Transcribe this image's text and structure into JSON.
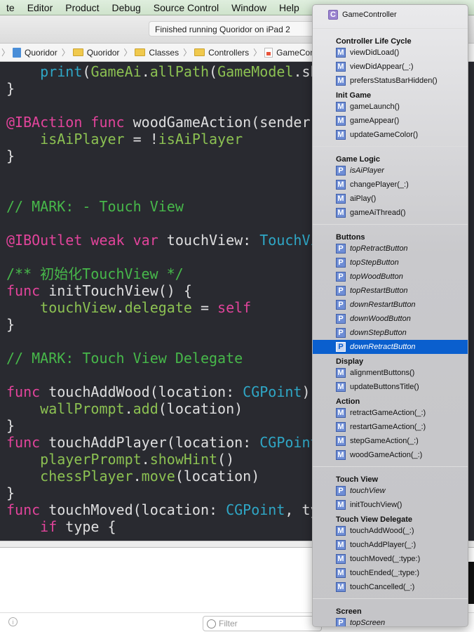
{
  "menubar": [
    "te",
    "Editor",
    "Product",
    "Debug",
    "Source Control",
    "Window",
    "Help"
  ],
  "toolbar": {
    "status": "Finished running Quoridor on iPad 2"
  },
  "breadcrumb": [
    {
      "icon": "project-icon",
      "label": "Quoridor"
    },
    {
      "icon": "folder-icon",
      "label": "Quoridor"
    },
    {
      "icon": "folder-icon",
      "label": "Classes"
    },
    {
      "icon": "folder-icon",
      "label": "Controllers"
    },
    {
      "icon": "swift-file-icon",
      "label": "GameController.swift"
    }
  ],
  "code": [
    [
      [
        "    ",
        "p"
      ],
      [
        "print",
        "t"
      ],
      [
        "(",
        "p"
      ],
      [
        "GameAi",
        "g"
      ],
      [
        ".",
        "p"
      ],
      [
        "allPath",
        "g"
      ],
      [
        "(",
        "p"
      ],
      [
        "GameModel",
        "g"
      ],
      [
        ".sh",
        "p"
      ]
    ],
    [
      [
        "}",
        "p"
      ]
    ],
    [],
    [
      [
        "@IBAction",
        "k"
      ],
      [
        " ",
        "p"
      ],
      [
        "func",
        "k"
      ],
      [
        " woodGameAction(sender",
        "p"
      ]
    ],
    [
      [
        "    ",
        "p"
      ],
      [
        "isAiPlayer",
        "g"
      ],
      [
        " = !",
        "p"
      ],
      [
        "isAiPlayer",
        "g"
      ]
    ],
    [
      [
        "}",
        "p"
      ]
    ],
    [],
    [],
    [
      [
        "// MARK: - Touch View",
        "c"
      ]
    ],
    [],
    [
      [
        "@IBOutlet",
        "k"
      ],
      [
        " ",
        "p"
      ],
      [
        "weak",
        "k"
      ],
      [
        " ",
        "p"
      ],
      [
        "var",
        "k"
      ],
      [
        " touchView: ",
        "p"
      ],
      [
        "TouchView",
        "t"
      ]
    ],
    [],
    [
      [
        "/** 初始化TouchView */",
        "c"
      ]
    ],
    [
      [
        "func",
        "k"
      ],
      [
        " initTouchView() {",
        "p"
      ]
    ],
    [
      [
        "    ",
        "p"
      ],
      [
        "touchView",
        "g"
      ],
      [
        ".",
        "p"
      ],
      [
        "delegate",
        "g"
      ],
      [
        " = ",
        "p"
      ],
      [
        "self",
        "k"
      ]
    ],
    [
      [
        "}",
        "p"
      ]
    ],
    [],
    [
      [
        "// MARK: Touch View Delegate",
        "c"
      ]
    ],
    [],
    [
      [
        "func",
        "k"
      ],
      [
        " touchAddWood(location: ",
        "p"
      ],
      [
        "CGPoint",
        "t"
      ],
      [
        ")",
        "p"
      ]
    ],
    [
      [
        "    ",
        "p"
      ],
      [
        "wallPrompt",
        "g"
      ],
      [
        ".",
        "p"
      ],
      [
        "add",
        "g"
      ],
      [
        "(location)",
        "p"
      ]
    ],
    [
      [
        "}",
        "p"
      ]
    ],
    [
      [
        "func",
        "k"
      ],
      [
        " touchAddPlayer(location: ",
        "p"
      ],
      [
        "CGPoint",
        "t"
      ]
    ],
    [
      [
        "    ",
        "p"
      ],
      [
        "playerPrompt",
        "g"
      ],
      [
        ".",
        "p"
      ],
      [
        "showHint",
        "g"
      ],
      [
        "()",
        "p"
      ]
    ],
    [
      [
        "    ",
        "p"
      ],
      [
        "chessPlayer",
        "g"
      ],
      [
        ".",
        "p"
      ],
      [
        "move",
        "g"
      ],
      [
        "(location)",
        "p"
      ]
    ],
    [
      [
        "}",
        "p"
      ]
    ],
    [
      [
        "func",
        "k"
      ],
      [
        " touchMoved(location: ",
        "p"
      ],
      [
        "CGPoint",
        "t"
      ],
      [
        ", ty",
        "p"
      ]
    ],
    [
      [
        "    ",
        "p"
      ],
      [
        "if",
        "k"
      ],
      [
        " type {",
        "p"
      ]
    ]
  ],
  "bottom": {
    "filter_placeholder": "Filter"
  },
  "jump_menu": {
    "title": "GameController",
    "sections": [
      {
        "name": "Controller Life Cycle",
        "sep": false,
        "items": [
          {
            "k": "M",
            "label": "viewDidLoad()"
          },
          {
            "k": "M",
            "label": "viewDidAppear(_:)"
          },
          {
            "k": "M",
            "label": "prefersStatusBarHidden()"
          }
        ]
      },
      {
        "name": "Init Game",
        "sep": false,
        "items": [
          {
            "k": "M",
            "label": "gameLaunch()"
          },
          {
            "k": "M",
            "label": "gameAppear()"
          },
          {
            "k": "M",
            "label": "updateGameColor()"
          }
        ]
      },
      {
        "name": "Game Logic",
        "sep": true,
        "items": [
          {
            "k": "P",
            "label": "isAiPlayer"
          },
          {
            "k": "M",
            "label": "changePlayer(_:)"
          },
          {
            "k": "M",
            "label": "aiPlay()"
          },
          {
            "k": "M",
            "label": "gameAiThread()"
          }
        ]
      },
      {
        "name": "Buttons",
        "sep": true,
        "items": [
          {
            "k": "P",
            "label": "topRetractButton"
          },
          {
            "k": "P",
            "label": "topStepButton"
          },
          {
            "k": "P",
            "label": "topWoodButton"
          },
          {
            "k": "P",
            "label": "topRestartButton"
          },
          {
            "k": "P",
            "label": "downRestartButton"
          },
          {
            "k": "P",
            "label": "downWoodButton"
          },
          {
            "k": "P",
            "label": "downStepButton"
          },
          {
            "k": "P",
            "label": "downRetractButton",
            "selected": true
          }
        ]
      },
      {
        "name": "Display",
        "sep": false,
        "items": [
          {
            "k": "M",
            "label": "alignmentButtons()"
          },
          {
            "k": "M",
            "label": "updateButtonsTitle()"
          }
        ]
      },
      {
        "name": "Action",
        "sep": false,
        "items": [
          {
            "k": "M",
            "label": "retractGameAction(_:)"
          },
          {
            "k": "M",
            "label": "restartGameAction(_:)"
          },
          {
            "k": "M",
            "label": "stepGameAction(_:)"
          },
          {
            "k": "M",
            "label": "woodGameAction(_:)"
          }
        ]
      },
      {
        "name": "Touch View",
        "sep": true,
        "items": [
          {
            "k": "P",
            "label": "touchView"
          },
          {
            "k": "M",
            "label": "initTouchView()"
          }
        ]
      },
      {
        "name": "Touch View Delegate",
        "sep": false,
        "items": [
          {
            "k": "M",
            "label": "touchAddWood(_:)"
          },
          {
            "k": "M",
            "label": "touchAddPlayer(_:)"
          },
          {
            "k": "M",
            "label": "touchMoved(_:type:)"
          },
          {
            "k": "M",
            "label": "touchEnded(_:type:)"
          },
          {
            "k": "M",
            "label": "touchCancelled(_:)"
          }
        ]
      },
      {
        "name": "Screen",
        "sep": true,
        "items": [
          {
            "k": "P",
            "label": "topScreen"
          }
        ]
      }
    ],
    "more_icon": "▼",
    "selection_color": "#0a5fce"
  }
}
